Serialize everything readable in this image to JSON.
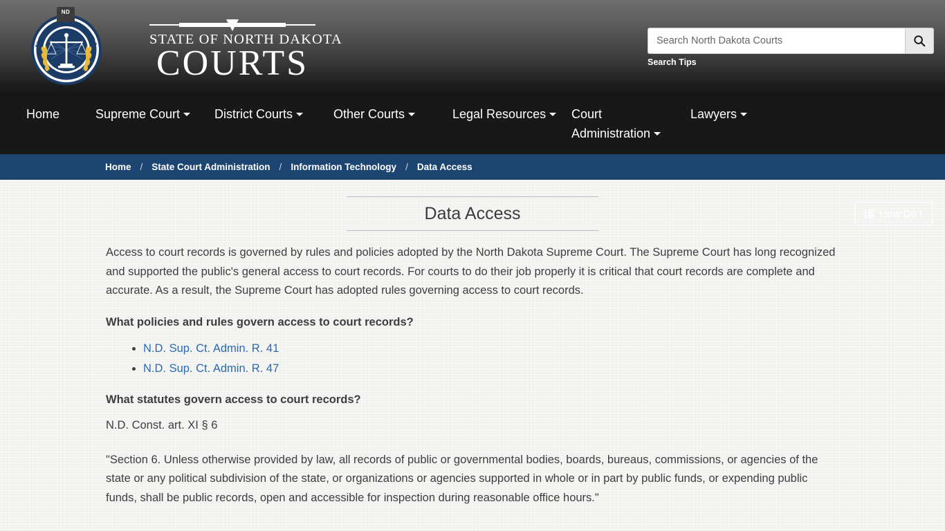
{
  "header": {
    "seal": {
      "nd_tab": "ND",
      "top_arc": "NORTH DAKOTA",
      "bottom_arc": "COURTS"
    },
    "wordmark": {
      "line1": "STATE OF NORTH DAKOTA",
      "line2": "COURTS"
    },
    "search": {
      "placeholder": "Search North Dakota Courts",
      "value": "",
      "button_icon": "search-icon",
      "tips_label": "Search Tips"
    }
  },
  "nav": {
    "items": [
      {
        "label": "Home",
        "has_dropdown": false
      },
      {
        "label": "Supreme Court",
        "has_dropdown": true
      },
      {
        "label": "District Courts",
        "has_dropdown": true
      },
      {
        "label": "Other Courts",
        "has_dropdown": true
      },
      {
        "label": "Legal Resources",
        "has_dropdown": true
      },
      {
        "label": "Court Administration",
        "has_dropdown": true
      },
      {
        "label": "Lawyers",
        "has_dropdown": true
      }
    ],
    "how_do_i": {
      "label": "How Do I",
      "icon": "list-menu-icon"
    }
  },
  "breadcrumb": {
    "separator": "/",
    "items": [
      {
        "label": "Home"
      },
      {
        "label": "State Court Administration"
      },
      {
        "label": "Information Technology"
      },
      {
        "label": "Data Access"
      }
    ]
  },
  "main": {
    "title": "Data Access",
    "intro": "Access to court records is governed by rules and policies adopted by the North Dakota Supreme Court. The Supreme Court has long recognized and supported the public's general access to court records. For courts to do their job properly it is critical that court records are complete and accurate. As a result, the Supreme Court has adopted rules governing access to court records.",
    "question_policies": "What policies and rules govern access to court records?",
    "rule_links": [
      {
        "label": "N.D. Sup. Ct. Admin. R. 41"
      },
      {
        "label": "N.D. Sup. Ct. Admin. R. 47"
      }
    ],
    "question_statutes": "What statutes govern access to court records?",
    "statute_citation": "N.D. Const. art. XI § 6",
    "statute_quote": "\"Section 6. Unless otherwise provided by law, all records of public or governmental bodies, boards, bureaus, commissions, or agencies of the state or any political subdivision of the state, or organizations or agencies supported in whole or in part by public funds, or expending public funds, shall be public records, open and accessible for inspection during reasonable office hours.\""
  },
  "colors": {
    "breadcrumb_blue": "#1d4572",
    "link_blue": "#2a6ab0",
    "nav_black": "#181818",
    "header_gradient_top": "#6f6f6f",
    "header_gradient_bottom": "#141414",
    "page_background": "#f5f5f3",
    "seal_navy": "#1b3c66",
    "seal_gold": "#e8b93c"
  }
}
